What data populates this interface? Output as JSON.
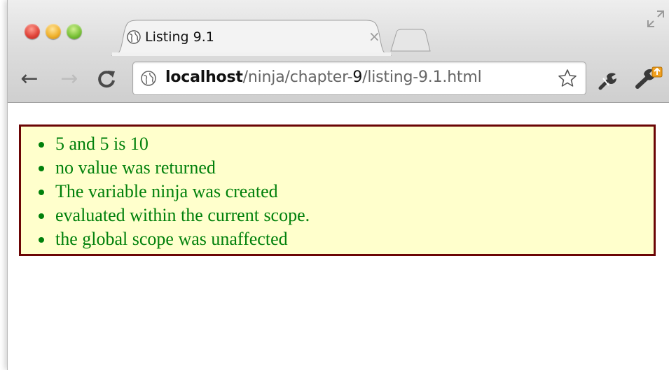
{
  "tab": {
    "title": "Listing 9.1",
    "close_glyph": "×"
  },
  "toolbar": {
    "back_glyph": "←",
    "forward_glyph": "→",
    "reload_glyph": "C"
  },
  "address": {
    "host": "localhost",
    "path_before": "/ninja/chapter-",
    "path_bold": "9",
    "path_after": "/listing-9.1.html"
  },
  "icons": {
    "favicon": "globe-icon",
    "omnibox": "globe-icon",
    "bookmark": "star-icon",
    "extension1": "tool-icon",
    "extension2": "wrench-update-icon",
    "fullscreen": "expand-icon"
  },
  "results": {
    "items": [
      "5 and 5 is 10",
      "no value was returned",
      "The variable ninja was created",
      "evaluated within the current scope.",
      "the global scope was unaffected"
    ]
  },
  "colors": {
    "result_text": "#00800b",
    "result_bg": "#ffffcc",
    "result_border": "#6b0505"
  }
}
